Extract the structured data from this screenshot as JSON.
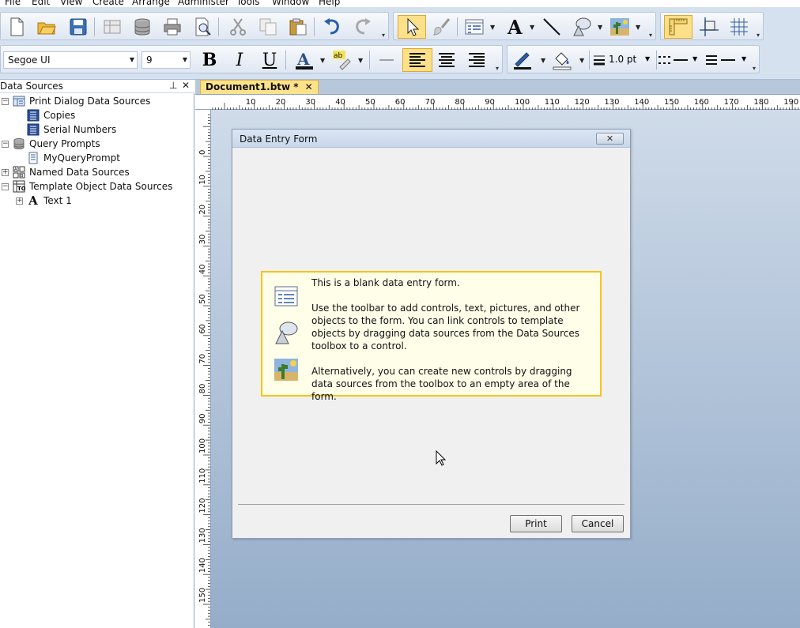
{
  "menu": [
    "File",
    "Edit",
    "View",
    "Create",
    "Arrange",
    "Administer",
    "Tools",
    "Window",
    "Help"
  ],
  "format_bar": {
    "font_name": "Segoe UI",
    "font_size": "9",
    "bold_label": "B",
    "italic_label": "I",
    "underline_label": "U",
    "line_width": "1.0 pt"
  },
  "left_pane": {
    "title": "Data Sources",
    "pin_glyph": "⊥",
    "close_glyph": "✕",
    "tree": [
      {
        "label": "Print Dialog Data Sources",
        "level": 0,
        "expander": "−",
        "icon": "print-dialog-sources-icon"
      },
      {
        "label": "Copies",
        "level": 1,
        "expander": "",
        "icon": "copies-source-icon"
      },
      {
        "label": "Serial Numbers",
        "level": 1,
        "expander": "",
        "icon": "serial-numbers-source-icon"
      },
      {
        "label": "Query Prompts",
        "level": 0,
        "expander": "−",
        "icon": "database-icon"
      },
      {
        "label": "MyQueryPrompt",
        "level": 1,
        "expander": "",
        "icon": "query-prompt-icon"
      },
      {
        "label": "Named Data Sources",
        "level": 0,
        "expander": "+",
        "icon": "named-sources-icon"
      },
      {
        "label": "Template Object Data Sources",
        "level": 0,
        "expander": "−",
        "icon": "template-object-sources-icon"
      },
      {
        "label": "Text 1",
        "level": 1,
        "expander": "+",
        "icon": "text-object-icon"
      }
    ]
  },
  "document": {
    "tab_label": "Document1.btw *",
    "tab_close": "✕",
    "h_ruler_labels": [
      "10",
      "20",
      "30",
      "40",
      "50",
      "60",
      "70",
      "80",
      "90",
      "100",
      "110",
      "120",
      "130",
      "140",
      "150",
      "160",
      "170",
      "180",
      "190"
    ],
    "v_ruler_labels": [
      "0",
      "10",
      "20",
      "30",
      "40",
      "50",
      "60",
      "70",
      "80",
      "90",
      "100",
      "110",
      "120",
      "130",
      "140",
      "150"
    ]
  },
  "dialog": {
    "title": "Data Entry Form",
    "close_glyph": "✕",
    "info_line1": "This is a blank data entry form.",
    "info_para2": "Use the toolbar to add controls, text, pictures, and other objects to the form.  You can link controls to template objects by dragging data sources from the Data Sources toolbox to a control.",
    "info_para3": "Alternatively, you can create new controls by dragging data sources from the toolbox to an empty area of the form.",
    "print_label": "Print",
    "cancel_label": "Cancel"
  },
  "colors": {
    "highlight": "#fde18a",
    "info_border": "#f5c518",
    "info_bg": "#fffee8",
    "canvas_top": "#cfdbe9",
    "canvas_bottom": "#95adc9"
  }
}
